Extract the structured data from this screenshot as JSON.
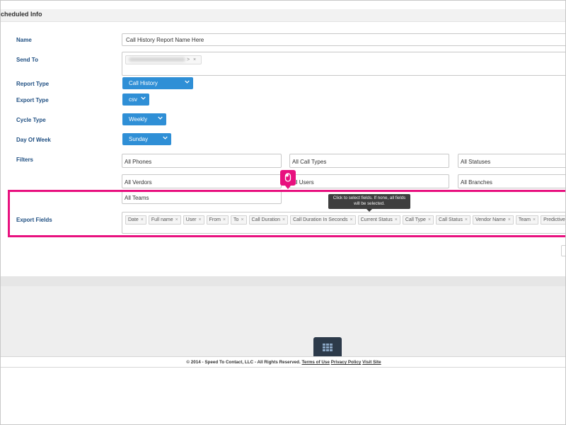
{
  "panel": {
    "title": "cheduled Info"
  },
  "labels": {
    "name": "Name",
    "send_to": "Send To",
    "report_type": "Report Type",
    "export_type": "Export Type",
    "cycle_type": "Cycle Type",
    "day_of_week": "Day Of Week",
    "filters": "Filters",
    "export_fields": "Export Fields"
  },
  "name_value": "Call History Report Name Here",
  "send_to": {
    "chip_suffix": ">",
    "chip_remove": "×"
  },
  "report_type": "Call History",
  "export_type": "csv",
  "cycle_type": "Weekly",
  "day_of_week": "Sunday",
  "filters": {
    "phones": "All Phones",
    "call_types": "All Call Types",
    "statuses": "All Statuses",
    "verdors": "All Verdors",
    "users": "ll Users",
    "branches": "All Branches",
    "teams": "All Teams"
  },
  "tooltip": "Click to select fields. If none, all fields will be selected.",
  "export_fields": [
    "Date",
    "Full name",
    "User",
    "From",
    "To",
    "Call Duration",
    "Call Duration In Seconds",
    "Current Status",
    "Call Type",
    "Call Status",
    "Vendor Name",
    "Team",
    "Predictive status"
  ],
  "tag_remove": "×",
  "footer": {
    "copyright": "© 2014 - Speed To Contact, LLC - All Rights Reserved.",
    "terms": "Terms of Use",
    "privacy": "Privacy Policy",
    "visit": "Visit Site"
  },
  "colors": {
    "accent": "#2f8fd6",
    "highlight": "#e8117f",
    "label": "#1f4f82",
    "apps_button": "#2c3a4a"
  },
  "icons": {
    "chevron": "chevron-down-icon",
    "marker": "mouse-icon",
    "apps": "grid-icon"
  }
}
